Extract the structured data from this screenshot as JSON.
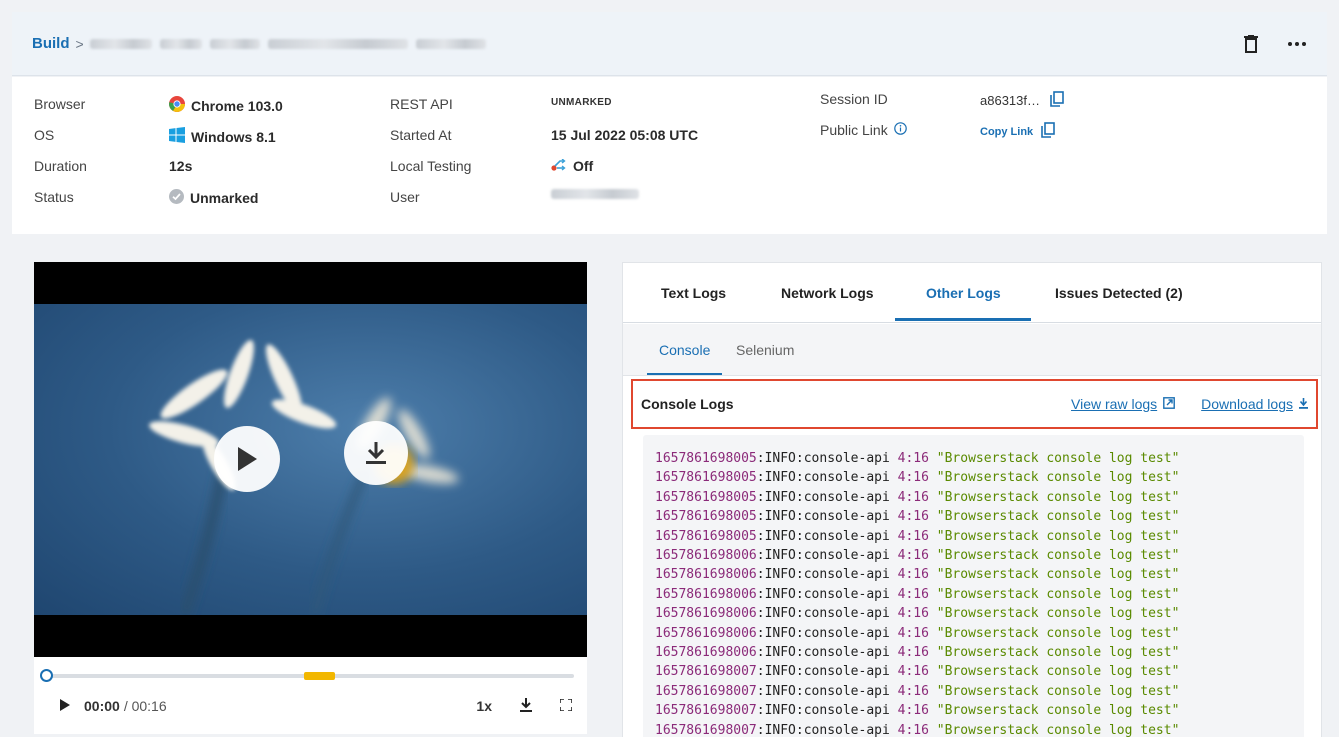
{
  "breadcrumb": {
    "root": "Build",
    "separator": ">"
  },
  "header": {
    "delete_icon": "trash-icon",
    "more_icon": "more-horizontal-icon"
  },
  "info": {
    "browser": {
      "label": "Browser",
      "value": "Chrome 103.0",
      "icon": "chrome-icon"
    },
    "os": {
      "label": "OS",
      "value": "Windows 8.1",
      "icon": "windows-icon"
    },
    "duration": {
      "label": "Duration",
      "value": "12s"
    },
    "status": {
      "label": "Status",
      "value": "Unmarked",
      "icon": "check-circle-icon"
    },
    "rest_api": {
      "label": "REST API",
      "value": "UNMARKED"
    },
    "started_at": {
      "label": "Started At",
      "value": "15 Jul 2022 05:08 UTC"
    },
    "local_testing": {
      "label": "Local Testing",
      "value": "Off",
      "icon": "local-testing-icon"
    },
    "user": {
      "label": "User"
    },
    "session_id": {
      "label": "Session ID",
      "value": "a86313f…",
      "icon": "copy-icon"
    },
    "public_link": {
      "label": "Public Link",
      "link_label": "Copy Link",
      "info_icon": "info-icon"
    }
  },
  "video": {
    "current_time": "00:00",
    "total_time": "/ 00:16",
    "speed": "1x",
    "progress": 0.0,
    "buffered_start": 0.49,
    "buffered_end": 0.55,
    "colors": {
      "accent": "#1a6fb3",
      "buffer": "#f2b700"
    }
  },
  "tabs": [
    {
      "label": "Text Logs",
      "active": false
    },
    {
      "label": "Network Logs",
      "active": false
    },
    {
      "label": "Other Logs",
      "active": true
    },
    {
      "label": "Issues Detected (2)",
      "active": false
    }
  ],
  "subtabs": [
    {
      "label": "Console",
      "active": true
    },
    {
      "label": "Selenium",
      "active": false
    }
  ],
  "console": {
    "title": "Console Logs",
    "view_raw": "View raw logs",
    "download": "Download logs",
    "colors": {
      "timestamp": "#8b2a79",
      "message": "#5a8a00",
      "highlight": "#e0472f"
    },
    "lines": [
      {
        "ts": "1657861698005",
        "level": ":INFO:console-api ",
        "loc": "4:16",
        "msg": " \"Browserstack console log test\""
      },
      {
        "ts": "1657861698005",
        "level": ":INFO:console-api ",
        "loc": "4:16",
        "msg": " \"Browserstack console log test\""
      },
      {
        "ts": "1657861698005",
        "level": ":INFO:console-api ",
        "loc": "4:16",
        "msg": " \"Browserstack console log test\""
      },
      {
        "ts": "1657861698005",
        "level": ":INFO:console-api ",
        "loc": "4:16",
        "msg": " \"Browserstack console log test\""
      },
      {
        "ts": "1657861698005",
        "level": ":INFO:console-api ",
        "loc": "4:16",
        "msg": " \"Browserstack console log test\""
      },
      {
        "ts": "1657861698006",
        "level": ":INFO:console-api ",
        "loc": "4:16",
        "msg": " \"Browserstack console log test\""
      },
      {
        "ts": "1657861698006",
        "level": ":INFO:console-api ",
        "loc": "4:16",
        "msg": " \"Browserstack console log test\""
      },
      {
        "ts": "1657861698006",
        "level": ":INFO:console-api ",
        "loc": "4:16",
        "msg": " \"Browserstack console log test\""
      },
      {
        "ts": "1657861698006",
        "level": ":INFO:console-api ",
        "loc": "4:16",
        "msg": " \"Browserstack console log test\""
      },
      {
        "ts": "1657861698006",
        "level": ":INFO:console-api ",
        "loc": "4:16",
        "msg": " \"Browserstack console log test\""
      },
      {
        "ts": "1657861698006",
        "level": ":INFO:console-api ",
        "loc": "4:16",
        "msg": " \"Browserstack console log test\""
      },
      {
        "ts": "1657861698007",
        "level": ":INFO:console-api ",
        "loc": "4:16",
        "msg": " \"Browserstack console log test\""
      },
      {
        "ts": "1657861698007",
        "level": ":INFO:console-api ",
        "loc": "4:16",
        "msg": " \"Browserstack console log test\""
      },
      {
        "ts": "1657861698007",
        "level": ":INFO:console-api ",
        "loc": "4:16",
        "msg": " \"Browserstack console log test\""
      },
      {
        "ts": "1657861698007",
        "level": ":INFO:console-api ",
        "loc": "4:16",
        "msg": " \"Browserstack console log test\""
      }
    ]
  }
}
